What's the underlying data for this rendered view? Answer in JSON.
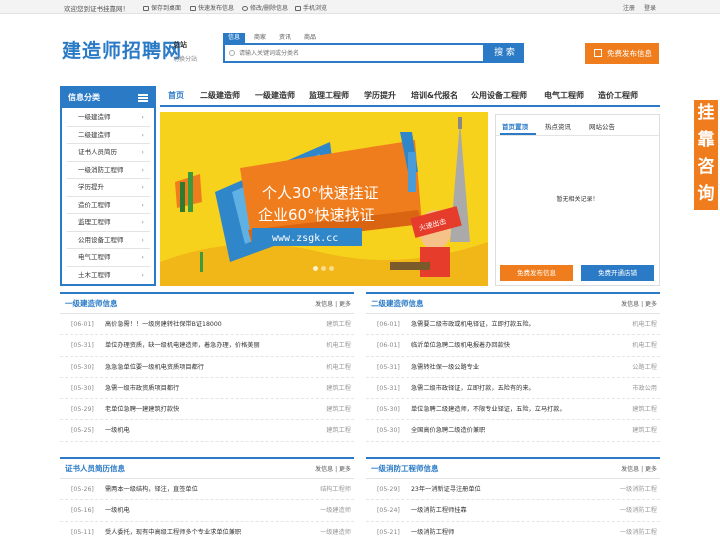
{
  "topbar": {
    "welcome": "欢迎您到证书挂靠网！",
    "links": [
      "保存到桌面",
      "快速发布信息",
      "修改/删除信息",
      "手机浏览"
    ],
    "login": "注册",
    "register": "登录"
  },
  "header": {
    "logo": "建造师招聘网",
    "station": "总站",
    "switch": "切换分站",
    "search_tabs": [
      "信息",
      "商家",
      "资讯",
      "商品"
    ],
    "search_placeholder": "请输入关键词或分类名",
    "search_button": "搜 索",
    "publish_button": "免费发布信息"
  },
  "sidebar": {
    "title": "信息分类",
    "items": [
      "一级建造师",
      "二级建造师",
      "证书人员简历",
      "一级消防工程师",
      "学历提升",
      "造价工程师",
      "监理工程师",
      "公用设备工程师",
      "电气工程师",
      "土木工程师"
    ]
  },
  "nav": {
    "items": [
      "首页",
      "二级建造师",
      "一级建造师",
      "监理工程师",
      "学历提升",
      "培训&代报名",
      "公用设备工程师",
      "电气工程师",
      "造价工程师"
    ]
  },
  "banner": {
    "line1": "个人30°快速挂证",
    "line2": "企业60°快速找证",
    "url": "www.zsgk.cc",
    "sign": "火速出击"
  },
  "infobox": {
    "tabs": [
      "首页置顶",
      "热点资讯",
      "网站公告"
    ],
    "empty": "暂无相关记录！",
    "btn_publish": "免费发布信息",
    "btn_shop": "免费开通店铺"
  },
  "sections": [
    {
      "title": "一级建造师信息",
      "more": "发信息 | 更多",
      "rows": [
        {
          "date": "[06-01]",
          "title": "高价急需！！一级房建转社保带B证18000",
          "tag": "建筑工程"
        },
        {
          "date": "[05-31]",
          "title": "单位办理资质，缺一级机电建造师，着急办理，价格美丽",
          "tag": "机电工程"
        },
        {
          "date": "[05-30]",
          "title": "急急急单位要一级机电资质项目都行",
          "tag": "机电工程"
        },
        {
          "date": "[05-30]",
          "title": "急需一级市政资质项目都行",
          "tag": "建筑工程"
        },
        {
          "date": "[05-29]",
          "title": "老单位急聘一建建筑打款快",
          "tag": "建筑工程"
        },
        {
          "date": "[05-25]",
          "title": "一级机电",
          "tag": "建筑工程"
        }
      ]
    },
    {
      "title": "二级建造师信息",
      "more": "发信息 | 更多",
      "rows": [
        {
          "date": "[06-01]",
          "title": "急需要二级市政或机电铎证，立即打款五险。",
          "tag": "机电工程"
        },
        {
          "date": "[06-01]",
          "title": "临沂单位急聘二级机电报着办回款快",
          "tag": "机电工程"
        },
        {
          "date": "[05-31]",
          "title": "急需转社保一级公路专业",
          "tag": "公路工程"
        },
        {
          "date": "[05-31]",
          "title": "急需二级市政铎证，立即打款，五险有的来。",
          "tag": "市政公用"
        },
        {
          "date": "[05-30]",
          "title": "单位急聘二级建造师，不限专业铎证，五险，立马打款。",
          "tag": "建筑工程"
        },
        {
          "date": "[05-30]",
          "title": "全国高价急聘二级造价兼职",
          "tag": "建筑工程"
        }
      ]
    },
    {
      "title": "证书人员简历信息",
      "more": "发信息 | 更多",
      "rows": [
        {
          "date": "[05-26]",
          "title": "需两本一级结构，铎注，直签单位",
          "tag": "结构工程师"
        },
        {
          "date": "[05-16]",
          "title": "一级机电",
          "tag": "一级建造师"
        },
        {
          "date": "[05-11]",
          "title": "受人委托，现有中高级工程师多个专业求单位兼职",
          "tag": "一级建造师"
        }
      ]
    },
    {
      "title": "一级消防工程师信息",
      "more": "发信息 | 更多",
      "rows": [
        {
          "date": "[05-29]",
          "title": "23年一消新证寻注册单位",
          "tag": "一级消防工程"
        },
        {
          "date": "[05-24]",
          "title": "一级消防工程师挂靠",
          "tag": "一级消防工程"
        },
        {
          "date": "[05-21]",
          "title": "一级消防工程师",
          "tag": "一级消防工程"
        }
      ]
    }
  ],
  "float_button": [
    "挂",
    "靠",
    "咨",
    "询"
  ],
  "colors": {
    "primary": "#2a7ac6",
    "accent": "#f07d1d"
  }
}
